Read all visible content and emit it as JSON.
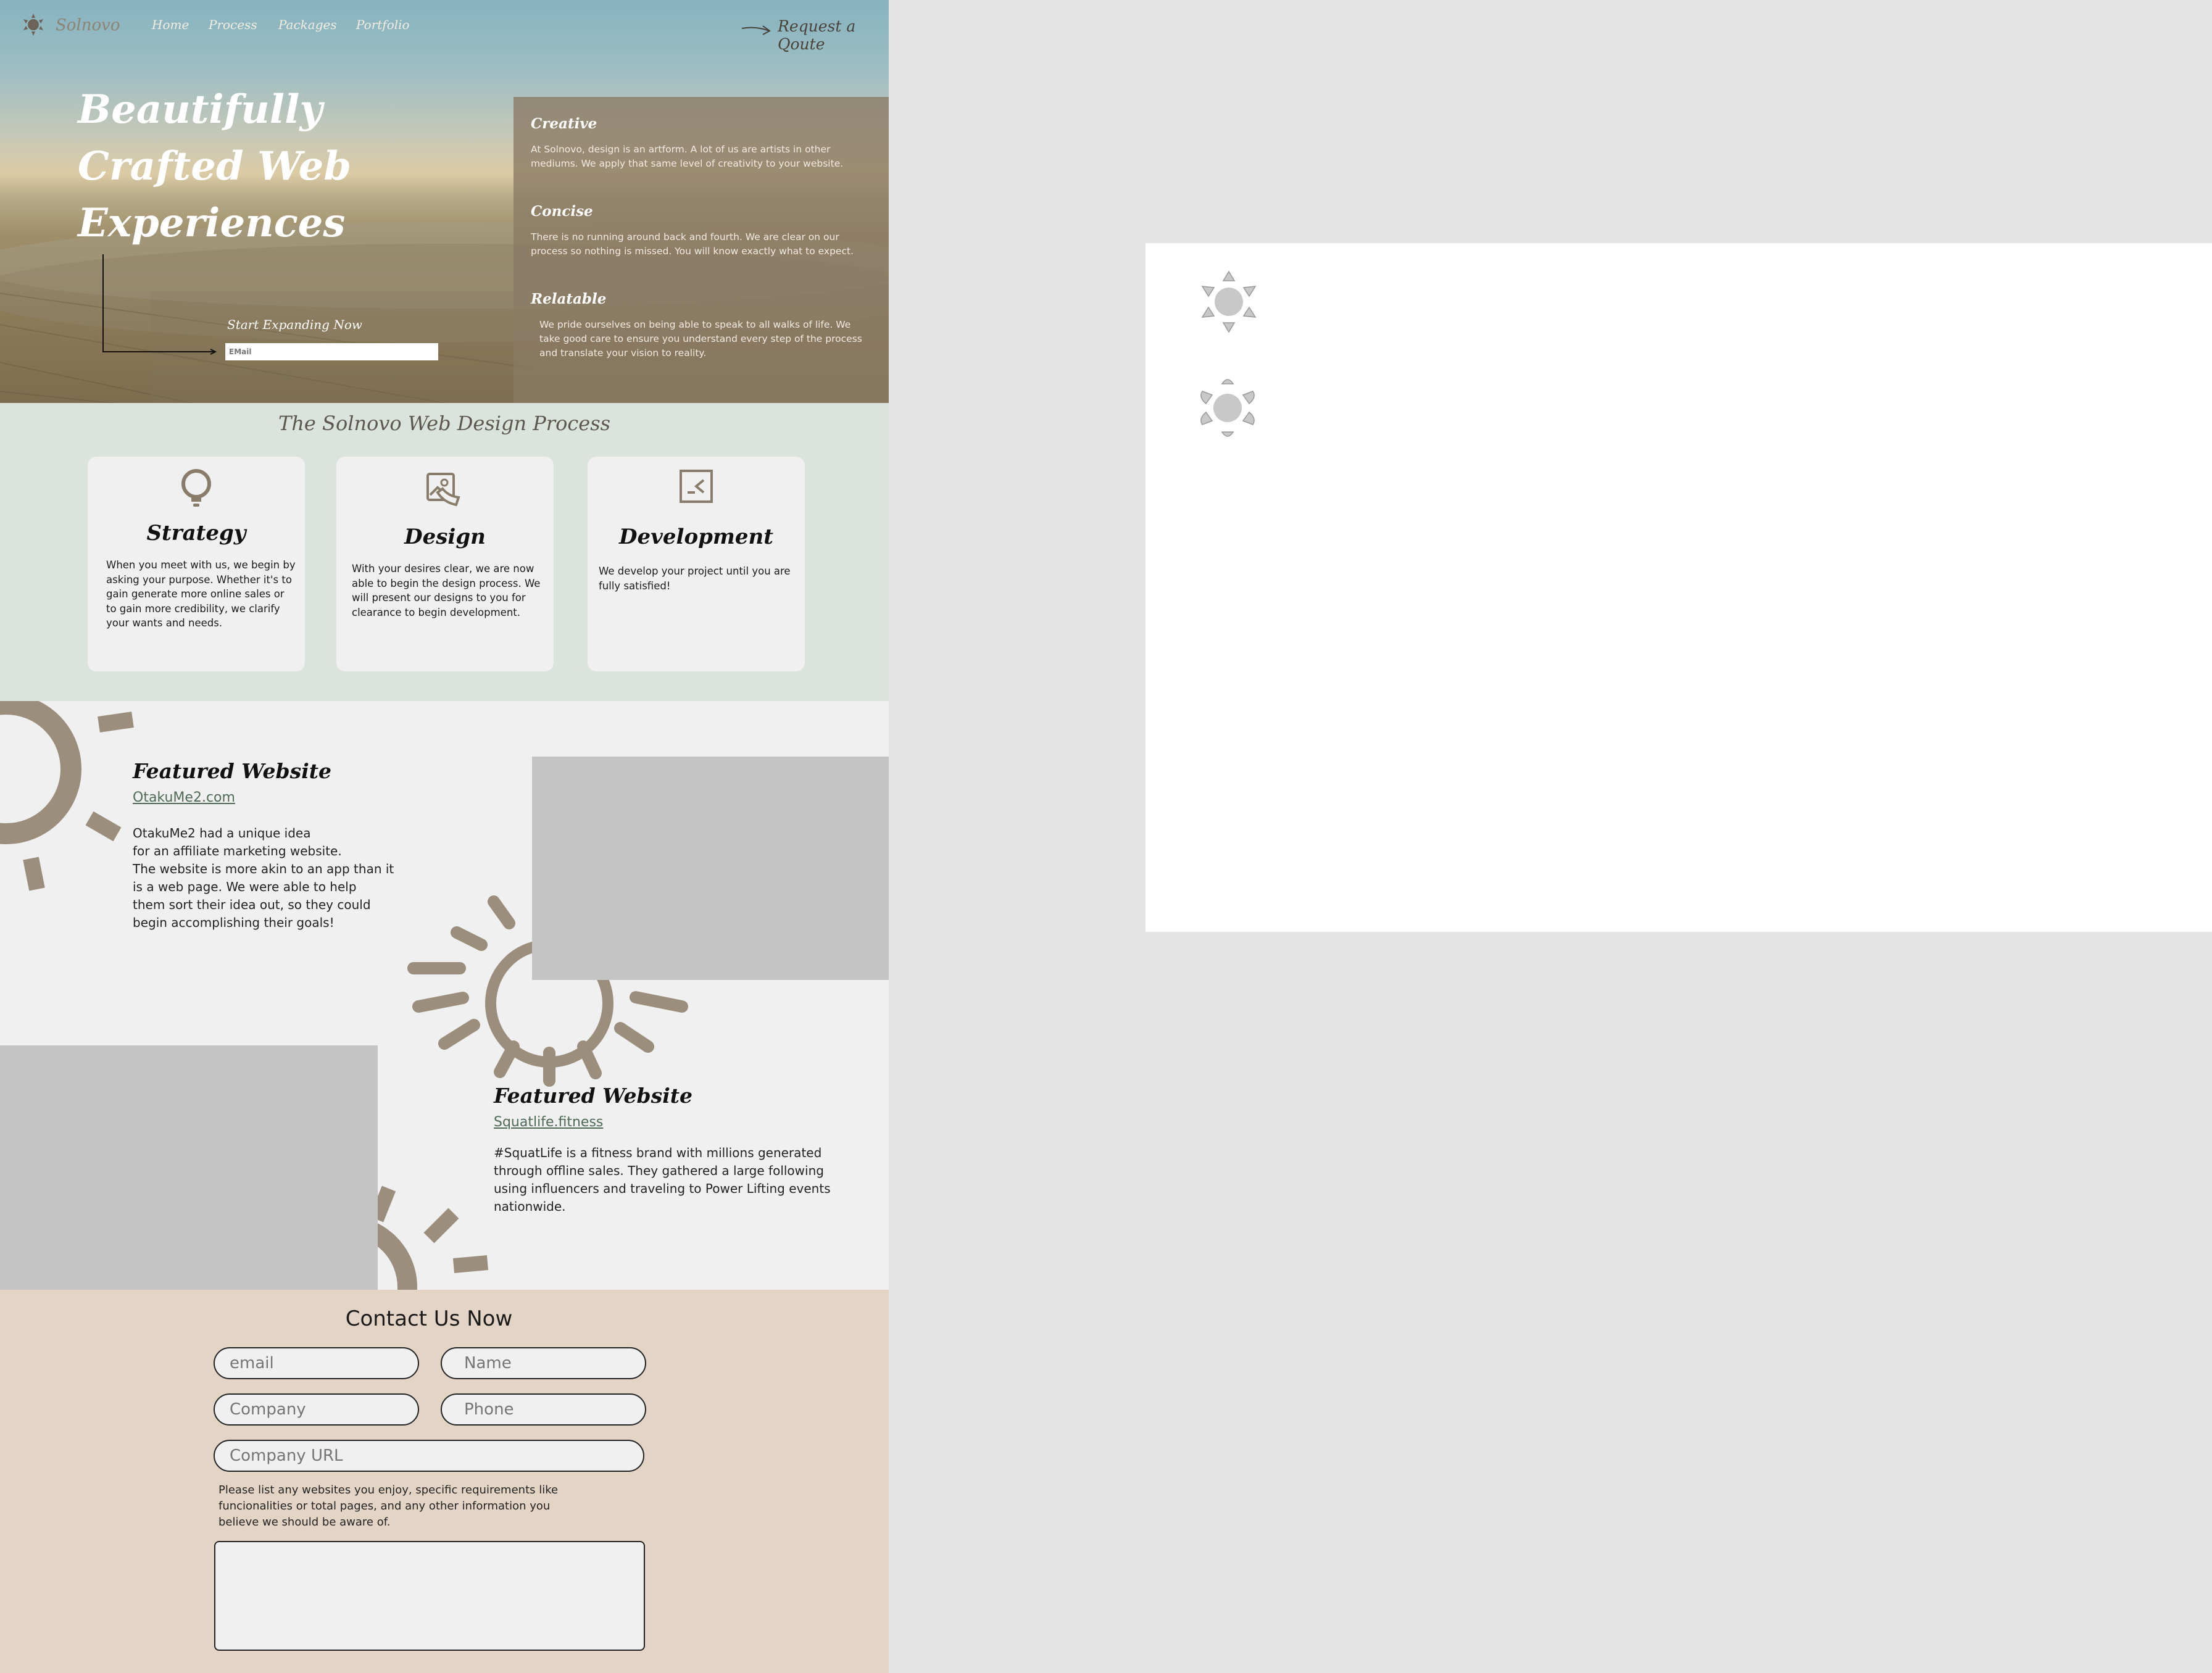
{
  "brand": {
    "name": "Solnovo",
    "logo_icon": "sun-logo-icon"
  },
  "nav": {
    "items": [
      "Home",
      "Process",
      "Packages",
      "Portfolio"
    ],
    "cta": "Request a Qoute"
  },
  "hero": {
    "title_lines": [
      "Beautifully",
      "Crafted Web",
      "Experiences"
    ],
    "cta_label": "Start Expanding Now",
    "email_placeholder": "EMail",
    "values": [
      {
        "title": "Creative",
        "text": "At Solnovo, design is an artform. A lot of us are artists in other mediums. We apply that same level of creativity to your website."
      },
      {
        "title": "Concise",
        "text": "There is no running around back and fourth. We are clear on our process so nothing is missed. You will know exactly what to expect."
      },
      {
        "title": "Relatable",
        "text": "We pride ourselves on being able to speak to all walks of life. We take good care to ensure you understand every step of the process and translate your vision to reality."
      }
    ]
  },
  "process": {
    "title": "The Solnovo Web Design Process",
    "cards": [
      {
        "title": "Strategy",
        "icon": "lightbulb-icon",
        "text": "When you meet with us, we begin by asking your purpose. Whether it's to gain generate more online sales or to gain more credibility, we clarify your wants and needs."
      },
      {
        "title": "Design",
        "icon": "image-edit-icon",
        "text": "With your desires clear, we are now able to begin the design process. We will present our designs to you for clearance to begin development."
      },
      {
        "title": "Development",
        "icon": "code-icon",
        "text": "We develop your project until you are fully satisfied!"
      }
    ]
  },
  "featured": [
    {
      "heading": "Featured Website",
      "link": "OtakuMe2.com",
      "text": "OtakuMe2 had a unique idea\nfor an affiliate marketing website.\nThe website is more akin to an app than it\nis a web page. We were able to help\n them sort their idea out, so they could\nbegin accomplishing their goals!"
    },
    {
      "heading": "Featured Website",
      "link": "Squatlife.fitness",
      "text": "#SquatLife is a fitness brand with millions generated\nthrough offline sales. They gathered a large following\n using influencers and traveling to Power Lifting events\nnationwide."
    }
  ],
  "contact": {
    "title": "Contact Us Now",
    "email_placeholder": "email",
    "name_placeholder": "Name",
    "company_placeholder": "Company",
    "phone_placeholder": "Phone",
    "url_placeholder": "Company URL",
    "note": "Please list any websites you enjoy, specific requirements like funcionalities or total pages, and any other information you believe we should be aware of."
  },
  "colors": {
    "sun_brown": "#9c8e7c",
    "process_bg": "#dae3dc",
    "contact_bg": "#e4d4c6",
    "panel_brown": "#8a7a64",
    "link_green": "#4f6b55"
  },
  "artboard_icons": [
    "sun-icon-triangles",
    "sun-icon-rounded"
  ]
}
